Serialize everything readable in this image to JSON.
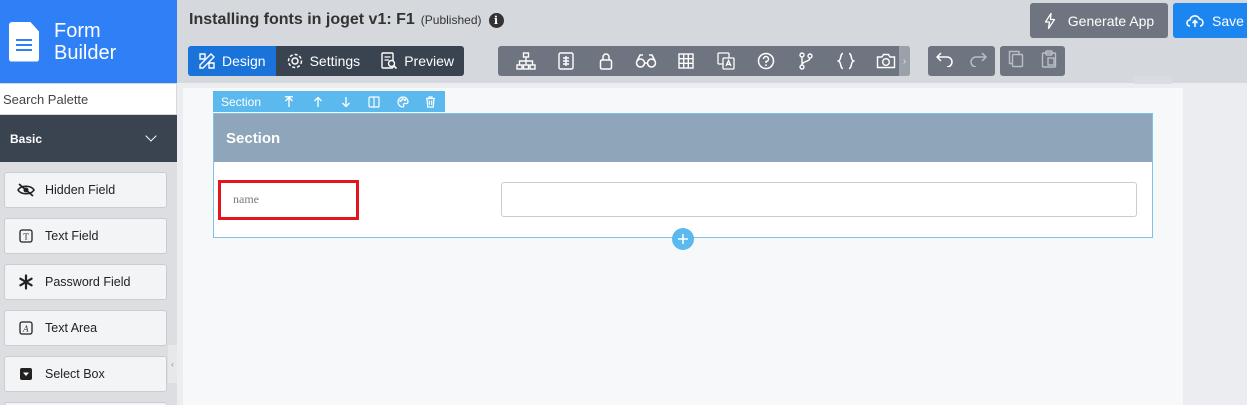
{
  "brand": {
    "title_line1": "Form",
    "title_line2": "Builder",
    "color": "#2f7ff6"
  },
  "header": {
    "title": "Installing fonts in joget v1: F1",
    "status": "(Published)",
    "generate_label": "Generate App",
    "save_label": "Save"
  },
  "modes": [
    {
      "label": "Design",
      "icon": "design-icon",
      "active": true
    },
    {
      "label": "Settings",
      "icon": "gear-icon",
      "active": false
    },
    {
      "label": "Preview",
      "icon": "preview-icon",
      "active": false
    }
  ],
  "tools": [
    "tree-icon",
    "list-icon",
    "lock-icon",
    "binoculars-icon",
    "grid-icon",
    "translate-icon",
    "help-icon",
    "branch-icon",
    "code-icon",
    "camera-icon"
  ],
  "sidebar": {
    "search_placeholder": "Search Palette",
    "category": "Basic",
    "items": [
      {
        "label": "Hidden Field",
        "icon": "eye-slash-icon"
      },
      {
        "label": "Text Field",
        "icon": "text-field-icon"
      },
      {
        "label": "Password Field",
        "icon": "asterisk-icon"
      },
      {
        "label": "Text Area",
        "icon": "text-area-icon"
      },
      {
        "label": "Select Box",
        "icon": "select-box-icon"
      }
    ]
  },
  "section": {
    "toolbar_label": "Section",
    "title": "Section",
    "field_label": "name",
    "field_value": ""
  }
}
